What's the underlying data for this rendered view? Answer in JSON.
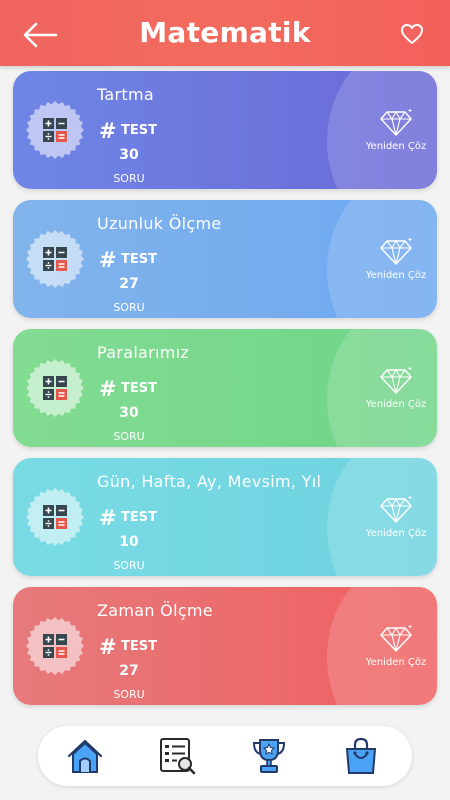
{
  "header": {
    "title": "Matematik",
    "back_icon": "arrow-left-icon",
    "favorite_icon": "heart-icon",
    "gradient_start": "#f0645f",
    "gradient_end": "#f3605b"
  },
  "cards": [
    {
      "title": "Tartma",
      "test_label": "TEST",
      "count": "30",
      "unit": "SORU",
      "retry": "Yeniden Çöz",
      "color_start": "#6f86e6",
      "color_end": "#6b68d6"
    },
    {
      "title": "Uzunluk Ölçme",
      "test_label": "TEST",
      "count": "27",
      "unit": "SORU",
      "retry": "Yeniden Çöz",
      "color_start": "#82b4ec",
      "color_end": "#6da8f0"
    },
    {
      "title": "Paralarımız",
      "test_label": "TEST",
      "count": "30",
      "unit": "SORU",
      "retry": "Yeniden Çöz",
      "color_start": "#82dc92",
      "color_end": "#70d488"
    },
    {
      "title": "Gün, Hafta, Ay, Mevsim, Yıl",
      "test_label": "TEST",
      "count": "10",
      "unit": "SORU",
      "retry": "Yeniden Çöz",
      "color_start": "#78dbe4",
      "color_end": "#6fd3e0"
    },
    {
      "title": "Zaman Ölçme",
      "test_label": "TEST",
      "count": "27",
      "unit": "SORU",
      "retry": "Yeniden Çöz",
      "color_start": "#e67a7c",
      "color_end": "#f06060"
    }
  ],
  "nav": {
    "items": [
      "home-icon",
      "test-list-search-icon",
      "trophy-icon",
      "shopping-bag-icon"
    ],
    "active": "home-icon"
  }
}
